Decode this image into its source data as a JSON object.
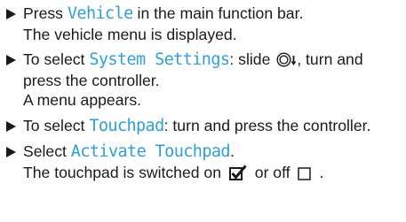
{
  "steps": [
    {
      "pre": "Press ",
      "ui": "Vehicle",
      "post": " in the main function bar.",
      "result": "The vehicle menu is displayed."
    },
    {
      "pre": "To select ",
      "ui": "System Settings",
      "mid": ": slide ",
      "post": ", turn and press the controller.",
      "result": "A menu appears."
    },
    {
      "pre": "To select ",
      "ui": "Touchpad",
      "post": ": turn and press the controller."
    },
    {
      "pre": "Select ",
      "ui": "Activate Touchpad",
      "post": ".",
      "result_pre": "The touchpad is switched on ",
      "result_mid": " or off ",
      "result_post": "."
    }
  ],
  "icons": {
    "step_bullet": "right-triangle-icon",
    "controller": "controller-slide-down-icon",
    "on_state": "checked-checkbox-icon",
    "off_state": "empty-checkbox-icon"
  },
  "colors": {
    "text": "#1a1a1a",
    "ui_term": "#2e9fd8"
  }
}
